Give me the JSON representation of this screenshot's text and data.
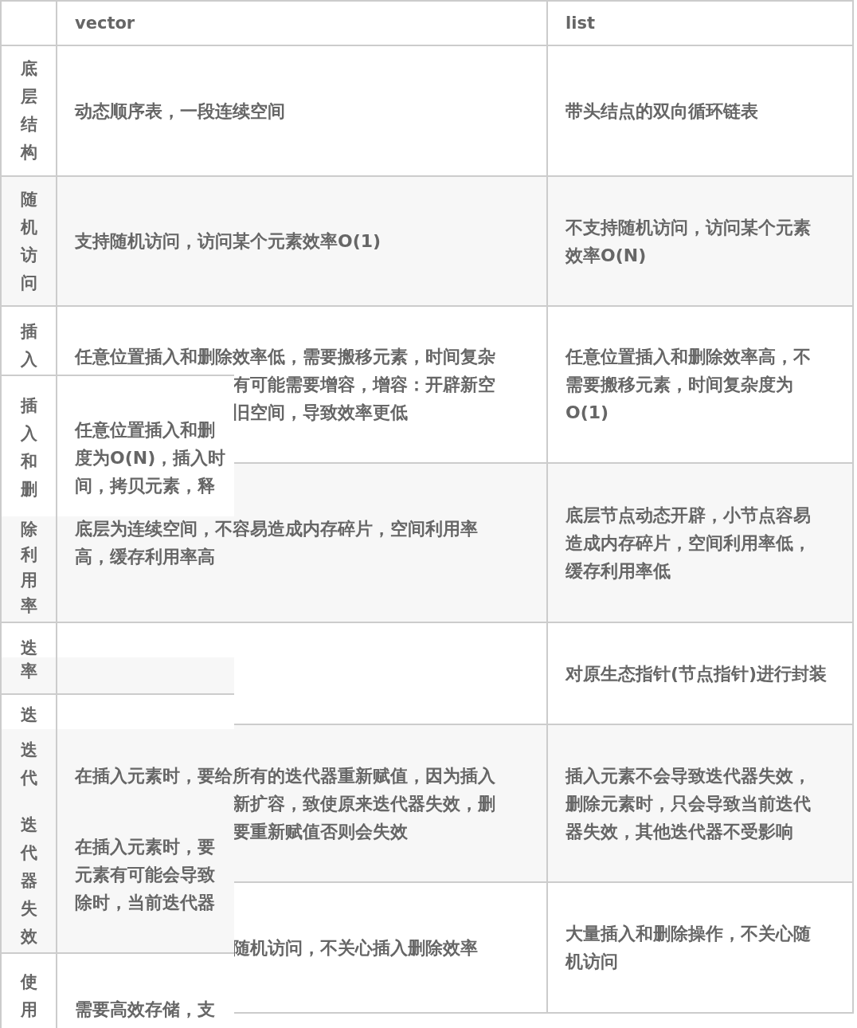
{
  "header": {
    "column_2": "vector",
    "column_3": "list"
  },
  "rows": [
    {
      "label": "底层结构",
      "vector": [
        {
          "kind": "whole",
          "text": "动态顺序表，一段连续空间"
        }
      ],
      "list": [
        "带头结点的双向循环链表"
      ]
    },
    {
      "label": "随机访问",
      "vector": [
        {
          "kind": "whole",
          "text": "支持随机访问，访问某个元素效率O(1)"
        }
      ],
      "list": [
        "不支持随机访问，访问某个元素",
        "效率O(N)"
      ]
    },
    {
      "label": "插入",
      "vector": [
        {
          "kind": "whole",
          "text": "任意位置插入和删除效率低，需要搬移元素，时间复杂"
        },
        {
          "kind": "tail",
          "text": "有可能需要增容，增容：开辟新空"
        },
        {
          "kind": "tail",
          "text": "旧空间，导致效率更低"
        }
      ],
      "list": [
        "任意位置插入和删除效率高，不",
        "需要搬移元素，时间复杂度为",
        "O(1)"
      ]
    },
    {
      "vector": [
        {
          "kind": "whole",
          "text": "底层为连续空间，不容易造成内存碎片，空间利用率"
        },
        {
          "kind": "whole",
          "text": "高，缓存利用率高"
        }
      ],
      "list": [
        "底层节点动态开辟，小节点容易",
        "造成内存碎片，空间利用率低，",
        "缓存利用率低"
      ]
    },
    {
      "label": "迭",
      "vector": [],
      "list": [
        "对原生态指针(节点指针)进行封装"
      ]
    },
    {
      "label": "迭代",
      "vector": [
        {
          "kind": "whole",
          "text": "在插入元素时，要给所有的迭代器重新赋值，因为插入"
        },
        {
          "kind": "tail",
          "text": "新扩容，致使原来迭代器失效，删"
        },
        {
          "kind": "tail",
          "text": "要重新赋值否则会失效"
        }
      ],
      "list": [
        "插入元素不会导致迭代器失效，",
        "删除元素时，只会导致当前迭代",
        "器失效，其他迭代器不受影响"
      ]
    },
    {
      "vector": [
        {
          "kind": "tail",
          "text": "随机访问，不关心插入删除效率"
        }
      ],
      "list": [
        "大量插入和删除操作，不关心随",
        "机访问"
      ]
    }
  ],
  "stale_overlay": [
    {
      "kind": "full",
      "label": "插入和删",
      "vector": [
        "任意位置插入和删",
        "度为O(N)，插入时",
        "间，拷贝元素，释"
      ]
    },
    {
      "kind": "label_only",
      "label": "除利用率"
    },
    {
      "kind": "full",
      "label": "率"
    },
    {
      "kind": "full",
      "label": "迭"
    },
    {
      "kind": "full",
      "label": "迭代器失效",
      "vector": [
        "在插入元素时，要",
        "元素有可能会导致",
        "除时，当前迭代器"
      ]
    },
    {
      "kind": "full",
      "label": "使用",
      "vector": [
        "需要高效存储，支"
      ]
    }
  ]
}
